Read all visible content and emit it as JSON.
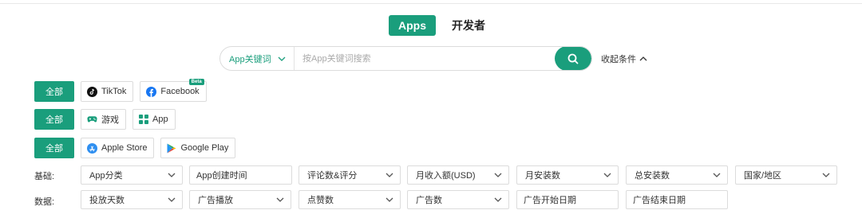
{
  "tabs": [
    {
      "label": "Apps",
      "active": true
    },
    {
      "label": "开发者",
      "active": false
    }
  ],
  "search": {
    "scope": "App关键词",
    "placeholder": "按App关键词搜索",
    "collapse_label": "收起条件"
  },
  "platform_row": {
    "all_label": "全部",
    "items": [
      {
        "label": "TikTok",
        "icon": "tiktok-icon"
      },
      {
        "label": "Facebook",
        "icon": "facebook-icon",
        "badge": "Beta"
      }
    ]
  },
  "type_row": {
    "all_label": "全部",
    "items": [
      {
        "label": "游戏",
        "icon": "gamepad-icon"
      },
      {
        "label": "App",
        "icon": "grid-icon"
      }
    ]
  },
  "store_row": {
    "all_label": "全部",
    "items": [
      {
        "label": "Apple Store",
        "icon": "app-store-icon"
      },
      {
        "label": "Google Play",
        "icon": "google-play-icon"
      }
    ]
  },
  "basic_filters": {
    "label": "基础:",
    "fields": [
      "App分类",
      "App创建时间",
      "评论数&评分",
      "月收入额(USD)",
      "月安装数",
      "总安装数",
      "国家/地区"
    ]
  },
  "data_filters": {
    "label": "数据:",
    "fields": [
      "投放天数",
      "广告播放",
      "点赞数",
      "广告数",
      "广告开始日期",
      "广告结束日期"
    ]
  },
  "colors": {
    "accent": "#1a9e7c"
  }
}
